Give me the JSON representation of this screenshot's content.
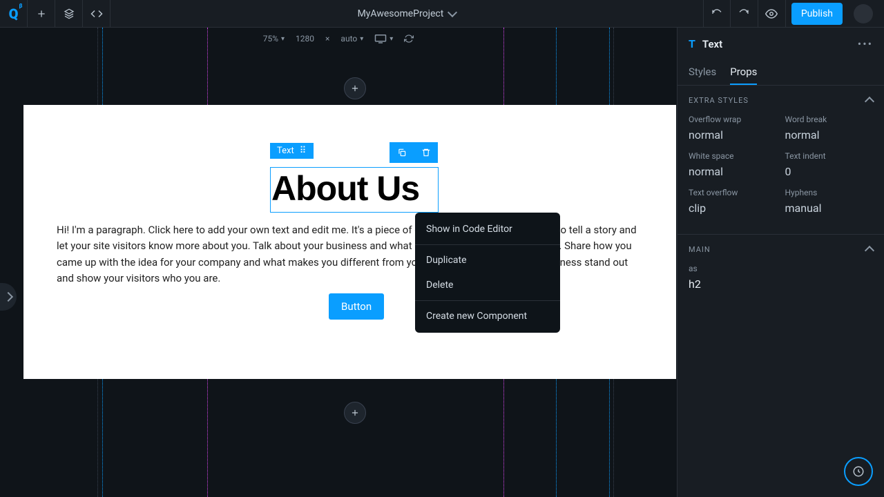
{
  "header": {
    "project": "MyAwesomeProject",
    "publish": "Publish"
  },
  "subbar": {
    "zoom": "75%",
    "width": "1280",
    "sep": "×",
    "height": "auto"
  },
  "selection": {
    "tag": "Text"
  },
  "canvas": {
    "heading": "About Us",
    "paragraph": "Hi! I'm a paragraph. Click here to add your own text and edit me. It's a piece of cake. I'm a great space for you to tell a story and let your site visitors know more about you. Talk about your business and what products and services you offer. Share how you came up with the idea for your company and what makes you different from your competitors. Make your business stand out and show your visitors who you are.",
    "button": "Button"
  },
  "context": {
    "show_code": "Show in Code Editor",
    "duplicate": "Duplicate",
    "delete": "Delete",
    "create_component": "Create new Component"
  },
  "panel": {
    "title": "Text",
    "tabs": {
      "styles": "Styles",
      "props": "Props"
    },
    "extra_styles": {
      "header": "EXTRA STYLES",
      "overflow_wrap": {
        "label": "Overflow wrap",
        "value": "normal"
      },
      "word_break": {
        "label": "Word break",
        "value": "normal"
      },
      "white_space": {
        "label": "White space",
        "value": "normal"
      },
      "text_indent": {
        "label": "Text indent",
        "value": "0"
      },
      "text_overflow": {
        "label": "Text overflow",
        "value": "clip"
      },
      "hyphens": {
        "label": "Hyphens",
        "value": "manual"
      }
    },
    "main_section": {
      "header": "MAIN",
      "as": {
        "label": "as",
        "value": "h2"
      }
    }
  }
}
